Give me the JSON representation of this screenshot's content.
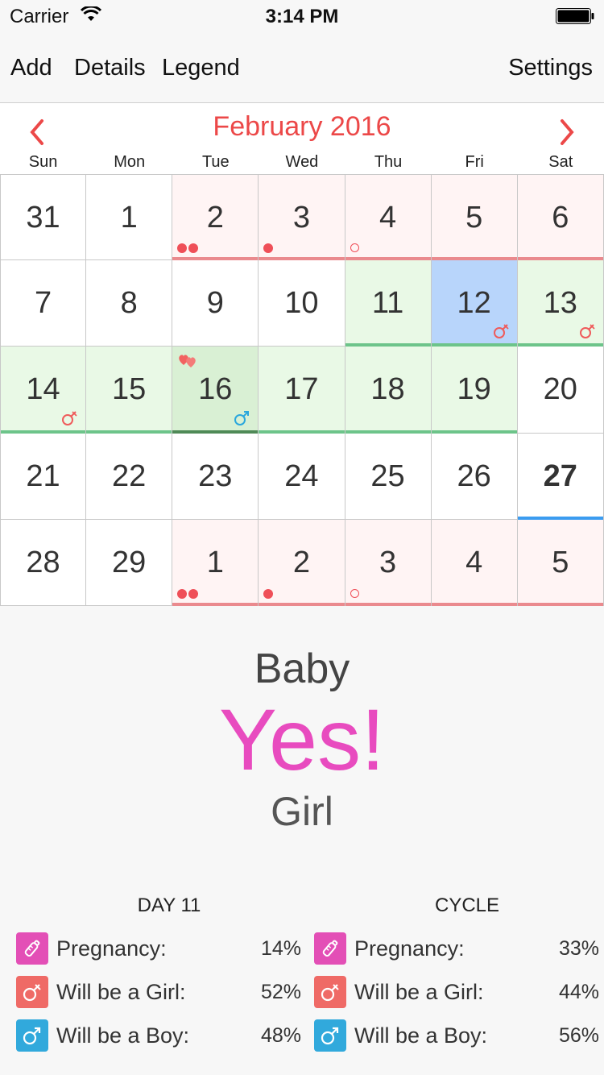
{
  "status_bar": {
    "carrier": "Carrier",
    "time": "3:14 PM"
  },
  "nav": {
    "add": "Add",
    "details": "Details",
    "legend": "Legend",
    "settings": "Settings"
  },
  "calendar": {
    "month": "February 2016",
    "weekdays": [
      "Sun",
      "Mon",
      "Tue",
      "Wed",
      "Thu",
      "Fri",
      "Sat"
    ],
    "days": [
      {
        "n": "31"
      },
      {
        "n": "1"
      },
      {
        "n": "2",
        "bg": "pink",
        "bar": "pinkbar",
        "dots": [
          "f",
          "f"
        ]
      },
      {
        "n": "3",
        "bg": "pink",
        "bar": "pinkbar",
        "dots": [
          "f"
        ]
      },
      {
        "n": "4",
        "bg": "pink",
        "bar": "pinkbar",
        "dots": [
          "h"
        ]
      },
      {
        "n": "5",
        "bg": "pink",
        "bar": "pinkbar"
      },
      {
        "n": "6",
        "bg": "pink",
        "bar": "pinkbar"
      },
      {
        "n": "7"
      },
      {
        "n": "8"
      },
      {
        "n": "9"
      },
      {
        "n": "10"
      },
      {
        "n": "11",
        "bg": "green",
        "bar": "greenbar"
      },
      {
        "n": "12",
        "bg": "blue",
        "bar": "greenbar",
        "sym": "girl"
      },
      {
        "n": "13",
        "bg": "green",
        "bar": "greenbar",
        "sym": "girl"
      },
      {
        "n": "14",
        "bg": "green",
        "bar": "greenbar",
        "sym": "girl"
      },
      {
        "n": "15",
        "bg": "green",
        "bar": "greenbar"
      },
      {
        "n": "16",
        "bg": "dkgreen",
        "bar": "dgreenbar",
        "sym": "boy",
        "hearts": true
      },
      {
        "n": "17",
        "bg": "green",
        "bar": "greenbar"
      },
      {
        "n": "18",
        "bg": "green",
        "bar": "greenbar"
      },
      {
        "n": "19",
        "bg": "green",
        "bar": "greenbar"
      },
      {
        "n": "20"
      },
      {
        "n": "21"
      },
      {
        "n": "22"
      },
      {
        "n": "23"
      },
      {
        "n": "24"
      },
      {
        "n": "25"
      },
      {
        "n": "26"
      },
      {
        "n": "27",
        "bar": "bluebar",
        "today": true
      },
      {
        "n": "28"
      },
      {
        "n": "29"
      },
      {
        "n": "1",
        "bg": "pink",
        "bar": "pinkbar",
        "dots": [
          "f",
          "f"
        ]
      },
      {
        "n": "2",
        "bg": "pink",
        "bar": "pinkbar",
        "dots": [
          "f"
        ]
      },
      {
        "n": "3",
        "bg": "pink",
        "bar": "pinkbar",
        "dots": [
          "h"
        ]
      },
      {
        "n": "4",
        "bg": "pink",
        "bar": "pinkbar"
      },
      {
        "n": "5",
        "bg": "pink",
        "bar": "pinkbar"
      }
    ]
  },
  "result": {
    "baby": "Baby",
    "yes": "Yes!",
    "gender": "Girl"
  },
  "stats": {
    "day": {
      "title": "DAY 11",
      "rows": [
        {
          "icon": "baby-bottle-icon",
          "label": "Pregnancy:",
          "value": "14%"
        },
        {
          "icon": "female-symbol-icon",
          "label": "Will be a Girl:",
          "value": "52%"
        },
        {
          "icon": "male-symbol-icon",
          "label": "Will be a Boy:",
          "value": "48%"
        }
      ]
    },
    "cycle": {
      "title": "CYCLE",
      "rows": [
        {
          "icon": "baby-bottle-icon",
          "label": "Pregnancy:",
          "value": "33%"
        },
        {
          "icon": "female-symbol-icon",
          "label": "Will be a Girl:",
          "value": "44%"
        },
        {
          "icon": "male-symbol-icon",
          "label": "Will be a Boy:",
          "value": "56%"
        }
      ]
    }
  },
  "colors": {
    "accent_red": "#ec4848",
    "yes_pink": "#e84bbf",
    "girl_red": "#ef6a66",
    "boy_blue": "#31a9dc",
    "fertile_green": "#e9f9e6",
    "period_pink": "#fff4f4"
  }
}
